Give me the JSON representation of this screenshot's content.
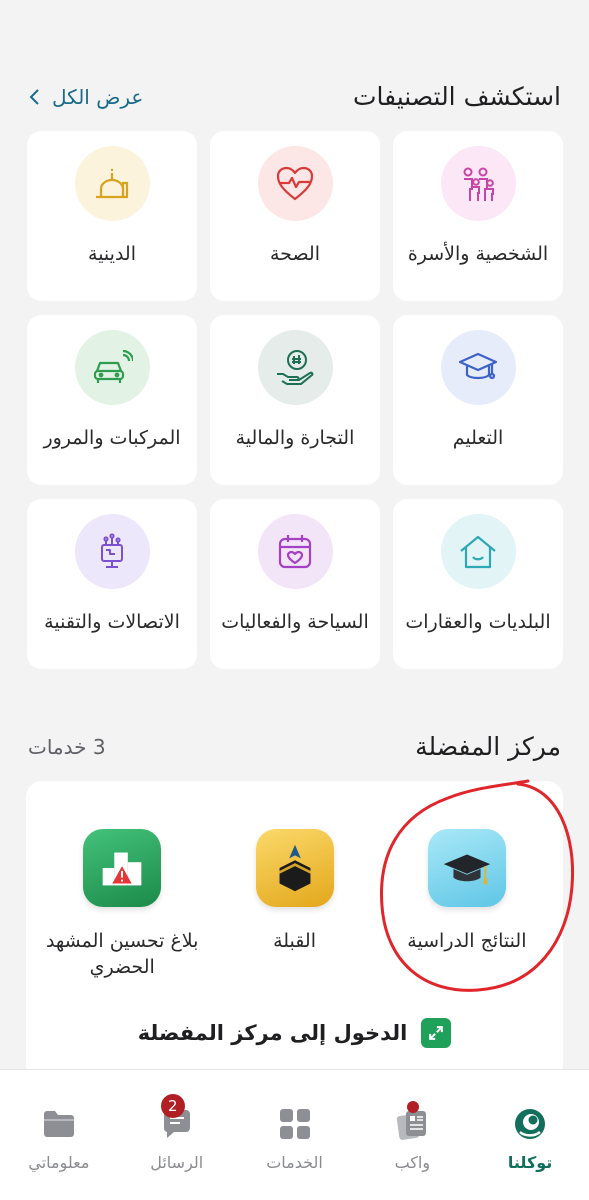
{
  "categories_section": {
    "title": "استكشف التصنيفات",
    "view_all": "عرض الكل"
  },
  "categories": [
    {
      "label": "الشخصية والأسرة",
      "icon": "family-icon",
      "bg": "#fbe7f5",
      "color": "#c944a8"
    },
    {
      "label": "الصحة",
      "icon": "heart-pulse-icon",
      "bg": "#fde6e6",
      "color": "#d93a3a"
    },
    {
      "label": "الدينية",
      "icon": "mosque-icon",
      "bg": "#fcf3dc",
      "color": "#d6a41e"
    },
    {
      "label": "التعليم",
      "icon": "graduation-cap-icon",
      "bg": "#e7ecfb",
      "color": "#3d63c9"
    },
    {
      "label": "التجارة والمالية",
      "icon": "money-hand-icon",
      "bg": "#e6ece9",
      "color": "#1f6f55"
    },
    {
      "label": "المركبات والمرور",
      "icon": "car-icon",
      "bg": "#e2f3e6",
      "color": "#2f9c52"
    },
    {
      "label": "البلديات والعقارات",
      "icon": "house-icon",
      "bg": "#e2f4f6",
      "color": "#2fa8b6"
    },
    {
      "label": "السياحة والفعاليات",
      "icon": "calendar-heart-icon",
      "bg": "#f3e5f8",
      "color": "#a541c4"
    },
    {
      "label": "الاتصالات والتقنية",
      "icon": "tech-icon",
      "bg": "#ece7fa",
      "color": "#7b51d0"
    }
  ],
  "favorites_section": {
    "title": "مركز المفضلة",
    "count": "3 خدمات",
    "items": [
      {
        "label": "النتائج الدراسية",
        "icon": "graduation-cap-app-icon"
      },
      {
        "label": "القبلة",
        "icon": "kaaba-app-icon"
      },
      {
        "label": "بلاغ تحسين المشهد الحضري",
        "icon": "urban-report-app-icon"
      }
    ],
    "enter_label": "الدخول إلى مركز المفضلة"
  },
  "tabs": [
    {
      "label": "توكلنا",
      "icon": "tawakkalna-logo-icon",
      "active": true
    },
    {
      "label": "واكب",
      "icon": "news-icon"
    },
    {
      "label": "الخدمات",
      "icon": "grid-icon"
    },
    {
      "label": "الرسائل",
      "icon": "chat-icon",
      "badge": "2"
    },
    {
      "label": "معلوماتي",
      "icon": "folder-icon"
    }
  ],
  "colors": {
    "accent": "#1b6a8a",
    "brand": "#126f5b",
    "badge": "#b11f24",
    "annotation": "#e0262b"
  }
}
